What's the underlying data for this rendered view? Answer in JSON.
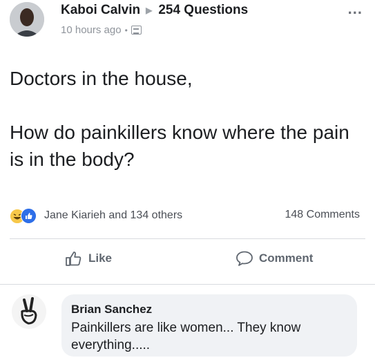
{
  "post": {
    "author": "Kaboi Calvin",
    "group": "254 Questions",
    "time": "10 hours ago",
    "more": "...",
    "line1": "Doctors in the house,",
    "line2": "How do painkillers know where the pain is in the body?"
  },
  "reactions": {
    "summary": "Jane Kiarieh and 134 others",
    "comments": "148 Comments",
    "icons": [
      "haha-icon",
      "like-icon"
    ]
  },
  "actions": {
    "like": "Like",
    "comment": "Comment"
  },
  "comment": {
    "author": "Brian Sanchez",
    "text": "Painkillers are like women... They know everything....."
  },
  "colors": {
    "like_blue": "#2e6fe8",
    "haha_yellow": "#f7c84a",
    "bubble": "#f0f2f5"
  }
}
